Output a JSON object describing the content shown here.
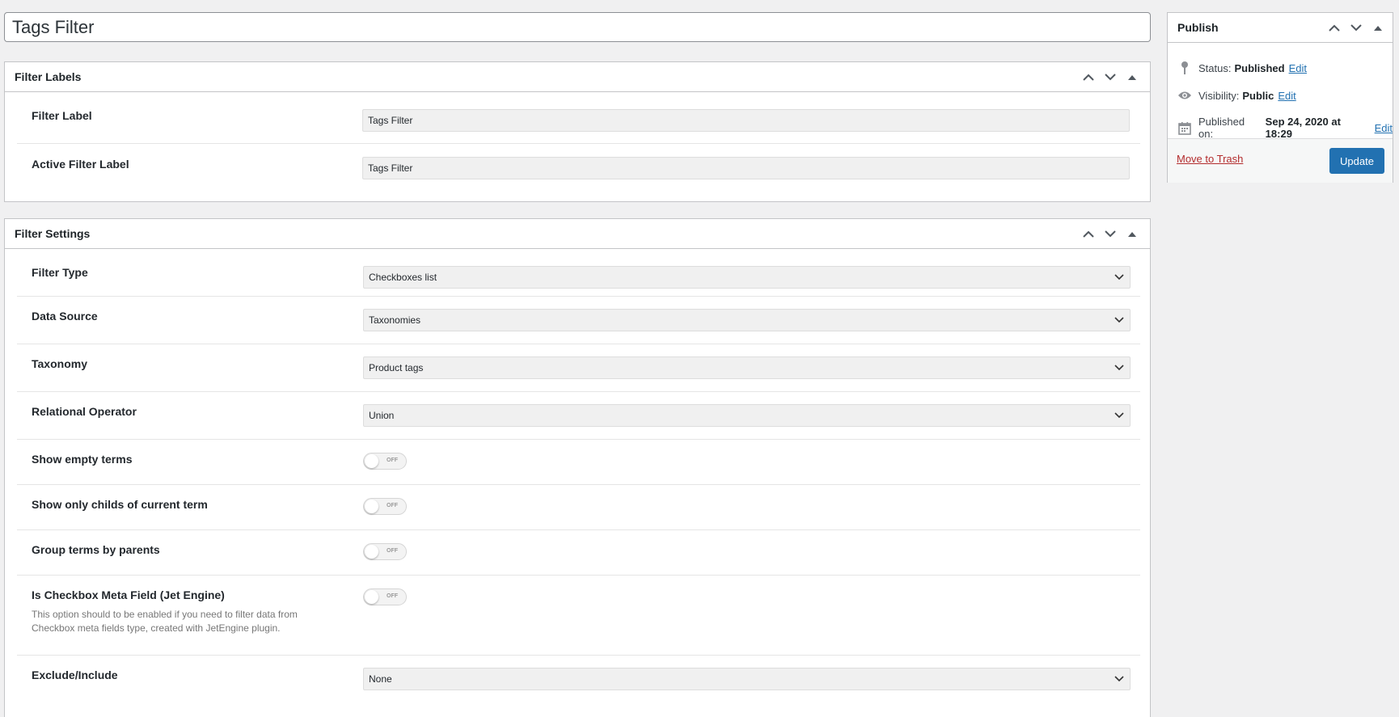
{
  "post_title": "Tags Filter",
  "filter_labels": {
    "title": "Filter Labels",
    "fields": [
      {
        "label": "Filter Label",
        "value": "Tags Filter"
      },
      {
        "label": "Active Filter Label",
        "value": "Tags Filter"
      }
    ]
  },
  "filter_settings": {
    "title": "Filter Settings",
    "filter_type": {
      "label": "Filter Type",
      "value": "Checkboxes list"
    },
    "data_source": {
      "label": "Data Source",
      "value": "Taxonomies"
    },
    "taxonomy": {
      "label": "Taxonomy",
      "value": "Product tags"
    },
    "relational_operator": {
      "label": "Relational Operator",
      "value": "Union"
    },
    "show_empty_terms": {
      "label": "Show empty terms",
      "state": "OFF"
    },
    "show_only_childs": {
      "label": "Show only childs of current term",
      "state": "OFF"
    },
    "group_terms": {
      "label": "Group terms by parents",
      "state": "OFF"
    },
    "is_checkbox_meta": {
      "label": "Is Checkbox Meta Field (Jet Engine)",
      "state": "OFF",
      "description": "This option should to be enabled if you need to filter data from Checkbox meta fields type, created with JetEngine plugin."
    },
    "exclude_include": {
      "label": "Exclude/Include",
      "value": "None"
    }
  },
  "publish": {
    "title": "Publish",
    "status_label": "Status:",
    "status_value": "Published",
    "visibility_label": "Visibility:",
    "visibility_value": "Public",
    "published_on_label": "Published on:",
    "published_on_value": "Sep 24, 2020 at 18:29",
    "edit_label": "Edit",
    "trash_label": "Move to Trash",
    "update_label": "Update",
    "accent_color": "#2271b1",
    "trash_color": "#b32d2e"
  }
}
